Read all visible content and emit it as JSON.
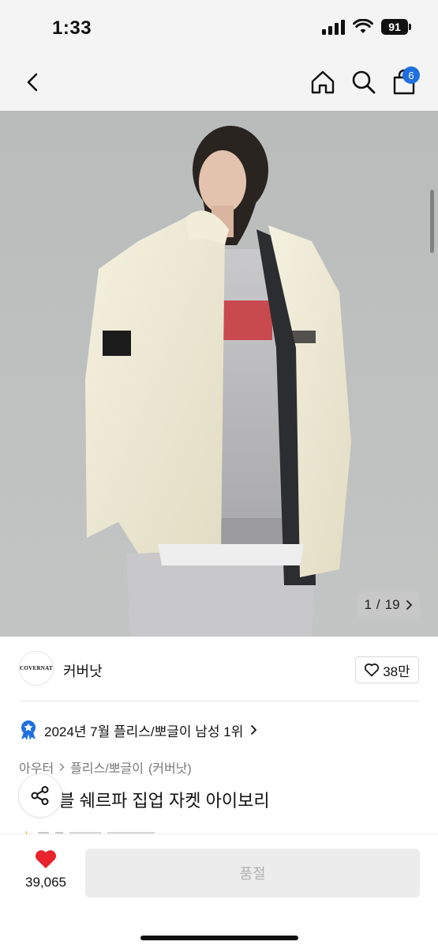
{
  "status_bar": {
    "time": "1:33",
    "battery": "91"
  },
  "nav": {
    "cart_count": "6"
  },
  "gallery": {
    "current": "1",
    "total": "19",
    "separator": "/"
  },
  "brand": {
    "name": "커버낫",
    "logo_text": "COVERNAT",
    "likes": "38만"
  },
  "ranking": {
    "text": "2024년 7월 플리스/뽀글이 남성 1위"
  },
  "category": {
    "level1": "아우터",
    "level2": "플리스/뽀글이",
    "brand": "(커버낫)"
  },
  "product": {
    "title_visible": "시블 쉐르파 집업 자켓 아이보리"
  },
  "bottom": {
    "wish_count": "39,065",
    "cta_label": "품절"
  },
  "colors": {
    "accent": "#1f6fe0",
    "heart": "#e8232d",
    "disabled_bg": "#ececec",
    "disabled_text": "#b3b3b3"
  }
}
